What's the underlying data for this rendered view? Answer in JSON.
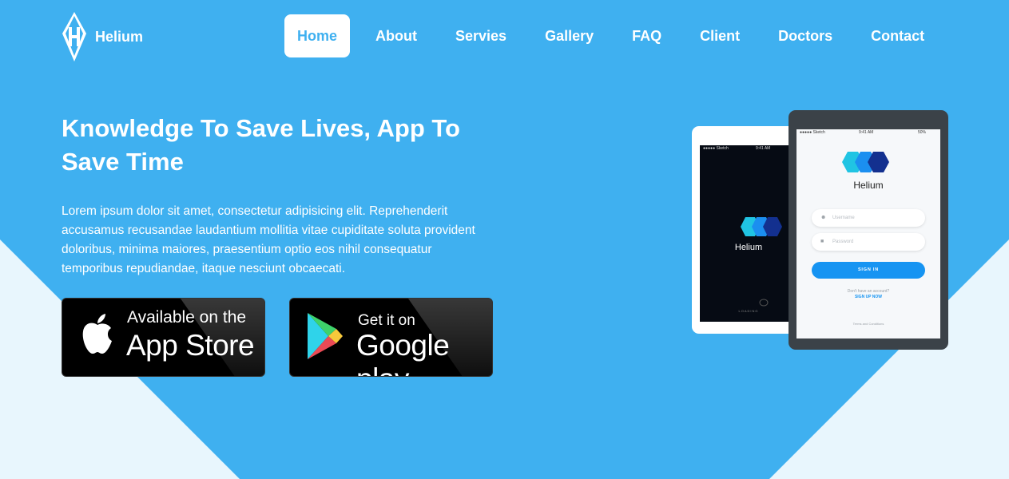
{
  "colors": {
    "background": "#3fb0f0",
    "light_shape": "#e8f6fd",
    "nav_active_text": "#3fb0f0",
    "signin_button": "#1694f2"
  },
  "header": {
    "logo_icon": "diamond-h-logo-icon",
    "brand_name": "Helium",
    "nav": [
      {
        "label": "Home",
        "active": true
      },
      {
        "label": "About",
        "active": false
      },
      {
        "label": "Servies",
        "active": false
      },
      {
        "label": "Gallery",
        "active": false
      },
      {
        "label": "FAQ",
        "active": false
      },
      {
        "label": "Client",
        "active": false
      },
      {
        "label": "Doctors",
        "active": false
      },
      {
        "label": "Contact",
        "active": false
      }
    ]
  },
  "hero": {
    "title_line1": "Knowledge To Save Lives, App To",
    "title_line2": "Save Time",
    "description": "Lorem ipsum dolor sit amet, consectetur adipisicing elit. Reprehenderit accusamus recusandae laudantium mollitia vitae cupiditate soluta provident doloribus, minima maiores, praesentium optio eos nihil consequatur temporibus repudiandae, itaque nesciunt obcaecati."
  },
  "store_buttons": {
    "appstore": {
      "icon": "apple-icon",
      "small": "Available on the",
      "big": "App Store"
    },
    "googleplay": {
      "icon": "google-play-icon",
      "small": "Get it on",
      "big": "Google play"
    }
  },
  "mockup": {
    "splash": {
      "status_carrier": "●●●●● Sketch",
      "status_time": "9:41 AM",
      "app_name": "Helium",
      "loading": "LOADING"
    },
    "login": {
      "status_carrier": "●●●●● Sketch",
      "status_time": "9:41 AM",
      "status_battery": "50%",
      "app_name": "Helium",
      "username_placeholder": "Username",
      "password_placeholder": "Password",
      "signin_label": "SIGN IN",
      "no_account": "Don't have an account?",
      "signup_label": "SIGN UP NOW",
      "terms": "Terms and Conditions"
    }
  }
}
